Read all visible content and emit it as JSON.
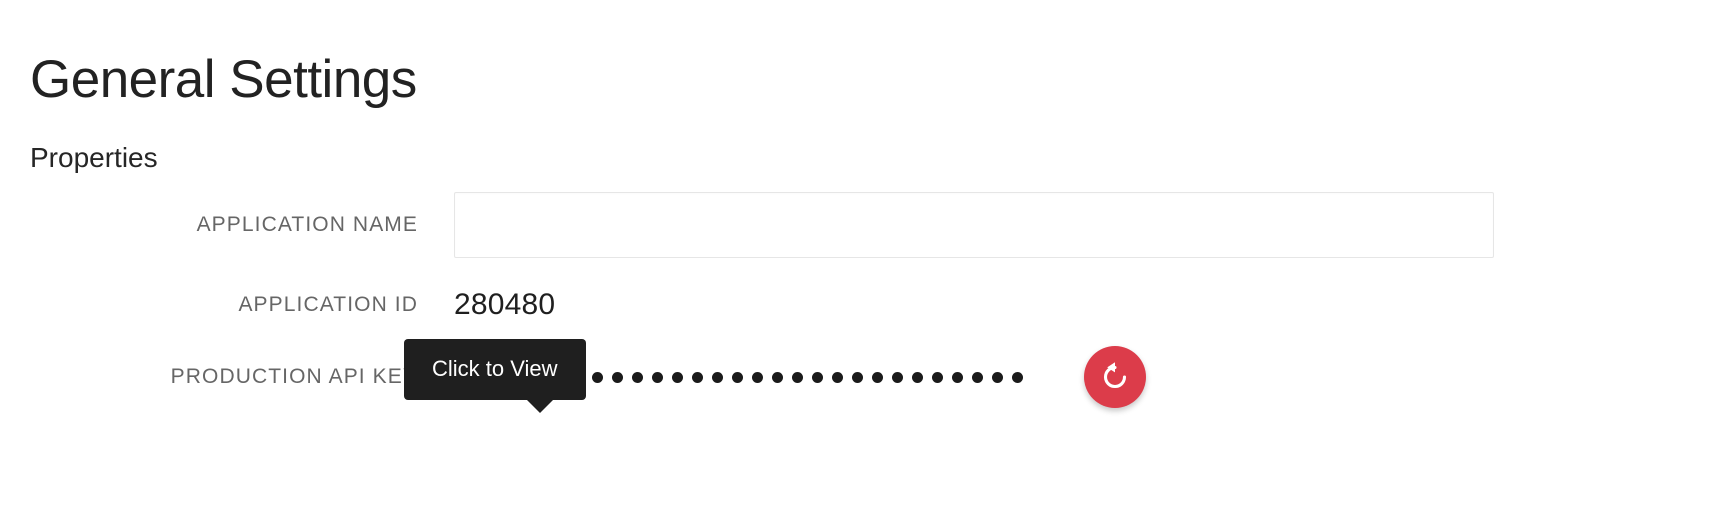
{
  "page": {
    "title": "General Settings",
    "section_heading": "Properties"
  },
  "form": {
    "application_name": {
      "label": "APPLICATION NAME",
      "value": "",
      "placeholder": ""
    },
    "application_id": {
      "label": "APPLICATION ID",
      "value": "280480"
    },
    "production_api_key": {
      "label": "PRODUCTION API KEY",
      "icon": "eye-icon",
      "masked_value": "••••••••••••••••••••••••••",
      "mask_dot_count": 26,
      "regenerate_icon": "rotate-ccw-icon"
    }
  },
  "tooltip": {
    "text": "Click to View",
    "background": "#1f1f1f",
    "text_color": "#ffffff"
  },
  "colors": {
    "accent_red": "#dc3c4a",
    "label_gray": "#666666",
    "input_border": "#e6e6e6",
    "text_dark": "#222222"
  }
}
